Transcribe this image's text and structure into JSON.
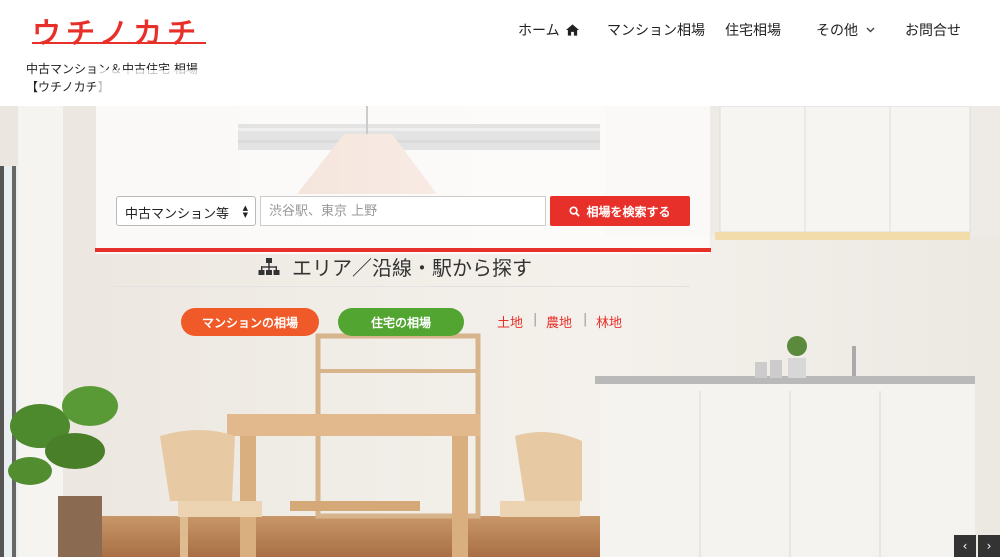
{
  "header": {
    "logo_text": "ウチノカチ",
    "tagline_line1": "中古マンション＆中古住宅 相場",
    "tagline_line2": "【ウチノカチ】",
    "nav": {
      "home": "ホーム",
      "mansion_price": "マンション相場",
      "house_price": "住宅相場",
      "other": "その他",
      "contact": "お問合せ"
    }
  },
  "search": {
    "type_selected": "中古マンション等",
    "input_placeholder": "渋谷駅、東京 上野",
    "button_label": "相場を検索する"
  },
  "area": {
    "heading": "エリア／沿線・駅から探す",
    "mansion_button": "マンションの相場",
    "house_button": "住宅の相場",
    "land_links": [
      "土地",
      "農地",
      "林地"
    ],
    "separator": "|"
  },
  "slider": {
    "prev": "‹",
    "next": "›"
  },
  "colors": {
    "accent": "#e8302a",
    "mansion": "#f05a28",
    "house": "#52a531"
  }
}
